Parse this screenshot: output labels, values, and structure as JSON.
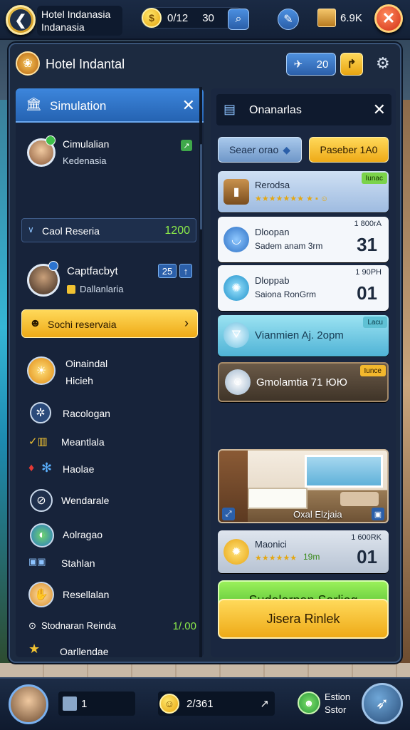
{
  "hud": {
    "hotel_name_line1": "Hotel Indanasia",
    "hotel_name_line2": "Indanasia",
    "coins_a": "0/12",
    "coins_b": "30",
    "crates": "6.9K"
  },
  "panel": {
    "title": "Hotel Indantal",
    "header_count": "20"
  },
  "left": {
    "tab_label": "Simulation",
    "profile1_name": "Cimulalian",
    "profile1_sub": "Kedenasia",
    "reserve_label": "Caol Reseria",
    "reserve_value": "1200",
    "profile2_name": "Captfacbyt",
    "profile2_badge": "25",
    "profile2_sub": "Dallanlaria",
    "yellow_bar_label": "Sochi reservaia",
    "item_large_line1": "Oinaindal",
    "item_large_line2": "Hicieh",
    "list": [
      {
        "label": "Racologan",
        "icon": "compass-icon"
      },
      {
        "label": "Meantlala",
        "icon": "chart-icon"
      },
      {
        "label": "Haolae",
        "icon": "snowflake-icon"
      },
      {
        "label": "Wendarale",
        "icon": "check-icon"
      },
      {
        "label": "Aolragao",
        "icon": "globe-icon"
      },
      {
        "label": "Stahlan",
        "icon": "people-icon"
      },
      {
        "label": "Resellalan",
        "icon": "hand-icon"
      },
      {
        "label": "Stodnaran Reinda",
        "icon": "clock-icon",
        "value": "1/.00"
      },
      {
        "label": "Oarllendae",
        "icon": "star-icon"
      }
    ]
  },
  "right": {
    "tab_label": "Onanarlas",
    "btn_blue": "Seaer orao",
    "btn_yellow": "Paseber 1A0",
    "cards": [
      {
        "title": "Rerodsa",
        "tag": "Iunac"
      },
      {
        "title": "Dloopan",
        "sub": "Sadem anam 3rm",
        "corner": "1 800rA",
        "big": "31"
      },
      {
        "title": "Dloppab",
        "sub": "Saiona RonGrm",
        "corner": "1 90PH",
        "big": "01"
      },
      {
        "title": "Vianmien Aj. 2opm",
        "tag": "Lacu"
      },
      {
        "title": "Gmolamtia 71 ЮЮ",
        "tag": "Iunce"
      },
      {
        "title": "Maonici",
        "sub": "19m",
        "corner": "1 600RK",
        "big": "01"
      }
    ],
    "room_caption": "Oxal Elzjaia",
    "green_btn": "Sudalarnan Sarliog",
    "yellow_btn": "Jisera Rinlek"
  },
  "bottom": {
    "slot1": "1",
    "coins": "2/361",
    "label_line1": "Estion",
    "label_line2": "Sstor"
  }
}
